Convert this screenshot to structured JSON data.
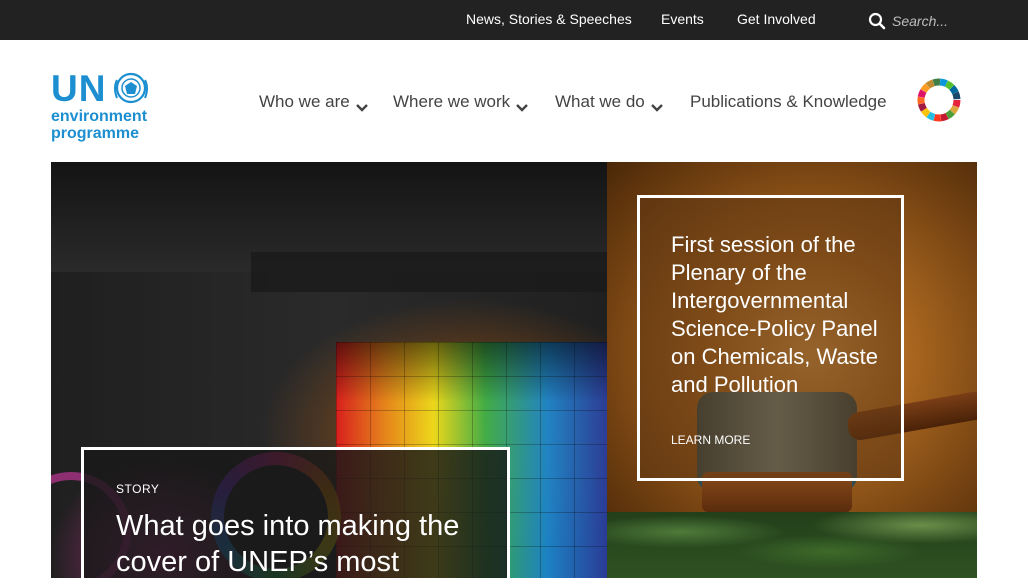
{
  "topbar": {
    "links": [
      "News, Stories & Speeches",
      "Events",
      "Get Involved"
    ],
    "search_placeholder": "Search...",
    "search_icon": "search-icon"
  },
  "logo": {
    "mark": "UN",
    "line1": "environment",
    "line2": "programme",
    "color": "#1d8fd0"
  },
  "nav": {
    "items": [
      {
        "label": "Who we are",
        "has_dropdown": true
      },
      {
        "label": "Where we work",
        "has_dropdown": true
      },
      {
        "label": "What we do",
        "has_dropdown": true
      },
      {
        "label": "Publications & Knowledge",
        "has_dropdown": false
      }
    ],
    "sdg_icon": "sdg-wheel-icon"
  },
  "hero": {
    "story": {
      "kicker": "STORY",
      "title": "What goes into making the cover of UNEP’s most"
    },
    "feature": {
      "title": "First session of the Plenary of the Intergovernmental Science-Policy Panel on Chemicals, Waste and Pollution",
      "cta": "LEARN MORE"
    }
  },
  "colors": {
    "topbar_bg": "#222222",
    "nav_text": "#444444",
    "brand_blue": "#1d8fd0"
  }
}
